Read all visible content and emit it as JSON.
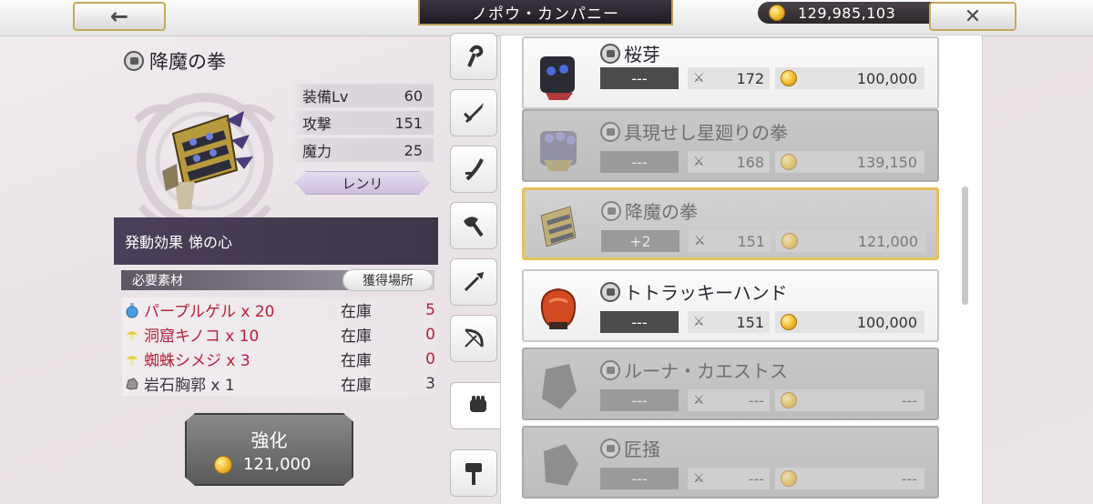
{
  "header": {
    "back_glyph": "←",
    "shop_title": "ノポウ・カンパニー",
    "money": "129,985,103",
    "close_glyph": "✕"
  },
  "item": {
    "name": "降魔の拳",
    "stats": [
      {
        "label": "装備Lv",
        "value": "60"
      },
      {
        "label": "攻撃",
        "value": "151"
      },
      {
        "label": "魔力",
        "value": "25"
      }
    ],
    "owner": "レンリ",
    "effect_label": "発動効果",
    "effect_value": "悌の心"
  },
  "materials": {
    "header": "必要素材",
    "obtain_label": "獲得場所",
    "stock_label": "在庫",
    "rows": [
      {
        "name": "パープルゲル x 20",
        "stock": "5",
        "icon": "potion-icon"
      },
      {
        "name": "洞窟キノコ x 10",
        "stock": "0",
        "icon": "mushroom-icon"
      },
      {
        "name": "蜘蛛シメジ x 3",
        "stock": "0",
        "icon": "mushroom-icon"
      },
      {
        "name": "岩石胸郭 x 1",
        "stock": "3",
        "icon": "rock-icon"
      }
    ]
  },
  "enhance": {
    "label": "強化",
    "cost": "121,000"
  },
  "tabs": [
    "staff-icon",
    "sword-icon",
    "katana-icon",
    "axe-icon",
    "spear-icon",
    "bow-icon",
    "fist-icon",
    "hammer-icon"
  ],
  "list": [
    {
      "name": "桜芽",
      "plus": "---",
      "atk": "172",
      "price": "100,000",
      "state": "normal"
    },
    {
      "name": "具現せし星廻りの拳",
      "plus": "---",
      "atk": "168",
      "price": "139,150",
      "state": "disabled"
    },
    {
      "name": "降魔の拳",
      "plus": "+2",
      "atk": "151",
      "price": "121,000",
      "state": "selected"
    },
    {
      "name": "トトラッキーハンド",
      "plus": "---",
      "atk": "151",
      "price": "100,000",
      "state": "normal"
    },
    {
      "name": "ルーナ・カエストス",
      "plus": "---",
      "atk": "---",
      "price": "---",
      "state": "disabled"
    },
    {
      "name": "匠掻",
      "plus": "---",
      "atk": "---",
      "price": "---",
      "state": "disabled"
    }
  ],
  "colors": {
    "accent_gold": "#c8a85b",
    "effect_bar": "#4a3f58",
    "missing_red": "#b5213a"
  }
}
